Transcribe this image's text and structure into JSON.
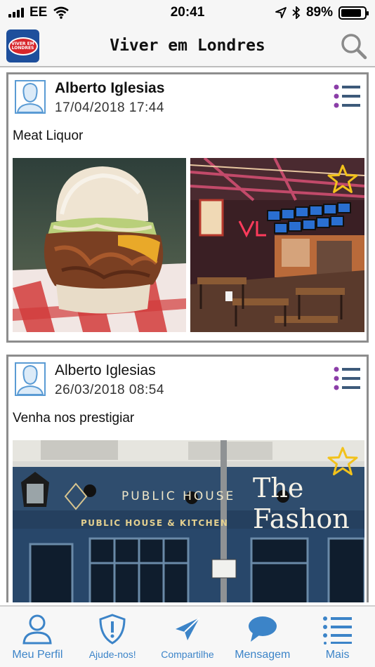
{
  "status_bar": {
    "carrier": "EE",
    "time": "20:41",
    "battery": "89%",
    "battery_level": 0.89
  },
  "header": {
    "title": "Viver em Londres",
    "logo_text": "VIVER EM LONDRES"
  },
  "posts": [
    {
      "author": "Alberto Iglesias",
      "date": "17/04/2018 17:44",
      "text": "Meat Liquor",
      "images": [
        "burger-photo",
        "restaurant-interior-photo"
      ]
    },
    {
      "author": "Alberto Iglesias",
      "date": "26/03/2018 08:54",
      "text": "Venha nos prestigiar",
      "images": [
        "pub-facade-photo"
      ],
      "image_signs": [
        "PUBLIC HOUSE",
        "PUBLIC HOUSE & KITCHEN",
        "The Fashon"
      ]
    }
  ],
  "tabs": [
    {
      "label": "Meu Perfil",
      "icon": "profile-icon"
    },
    {
      "label": "Ajude-nos!",
      "icon": "shield-icon"
    },
    {
      "label": "Compartilhe",
      "icon": "send-icon"
    },
    {
      "label": "Mensagem",
      "icon": "chat-bubble-icon"
    },
    {
      "label": "Mais",
      "icon": "list-icon"
    }
  ],
  "colors": {
    "accent": "#3c84c8",
    "menu_dot": "#8b3ea8",
    "star": "#f2c21b",
    "border": "#8d8d8d"
  }
}
